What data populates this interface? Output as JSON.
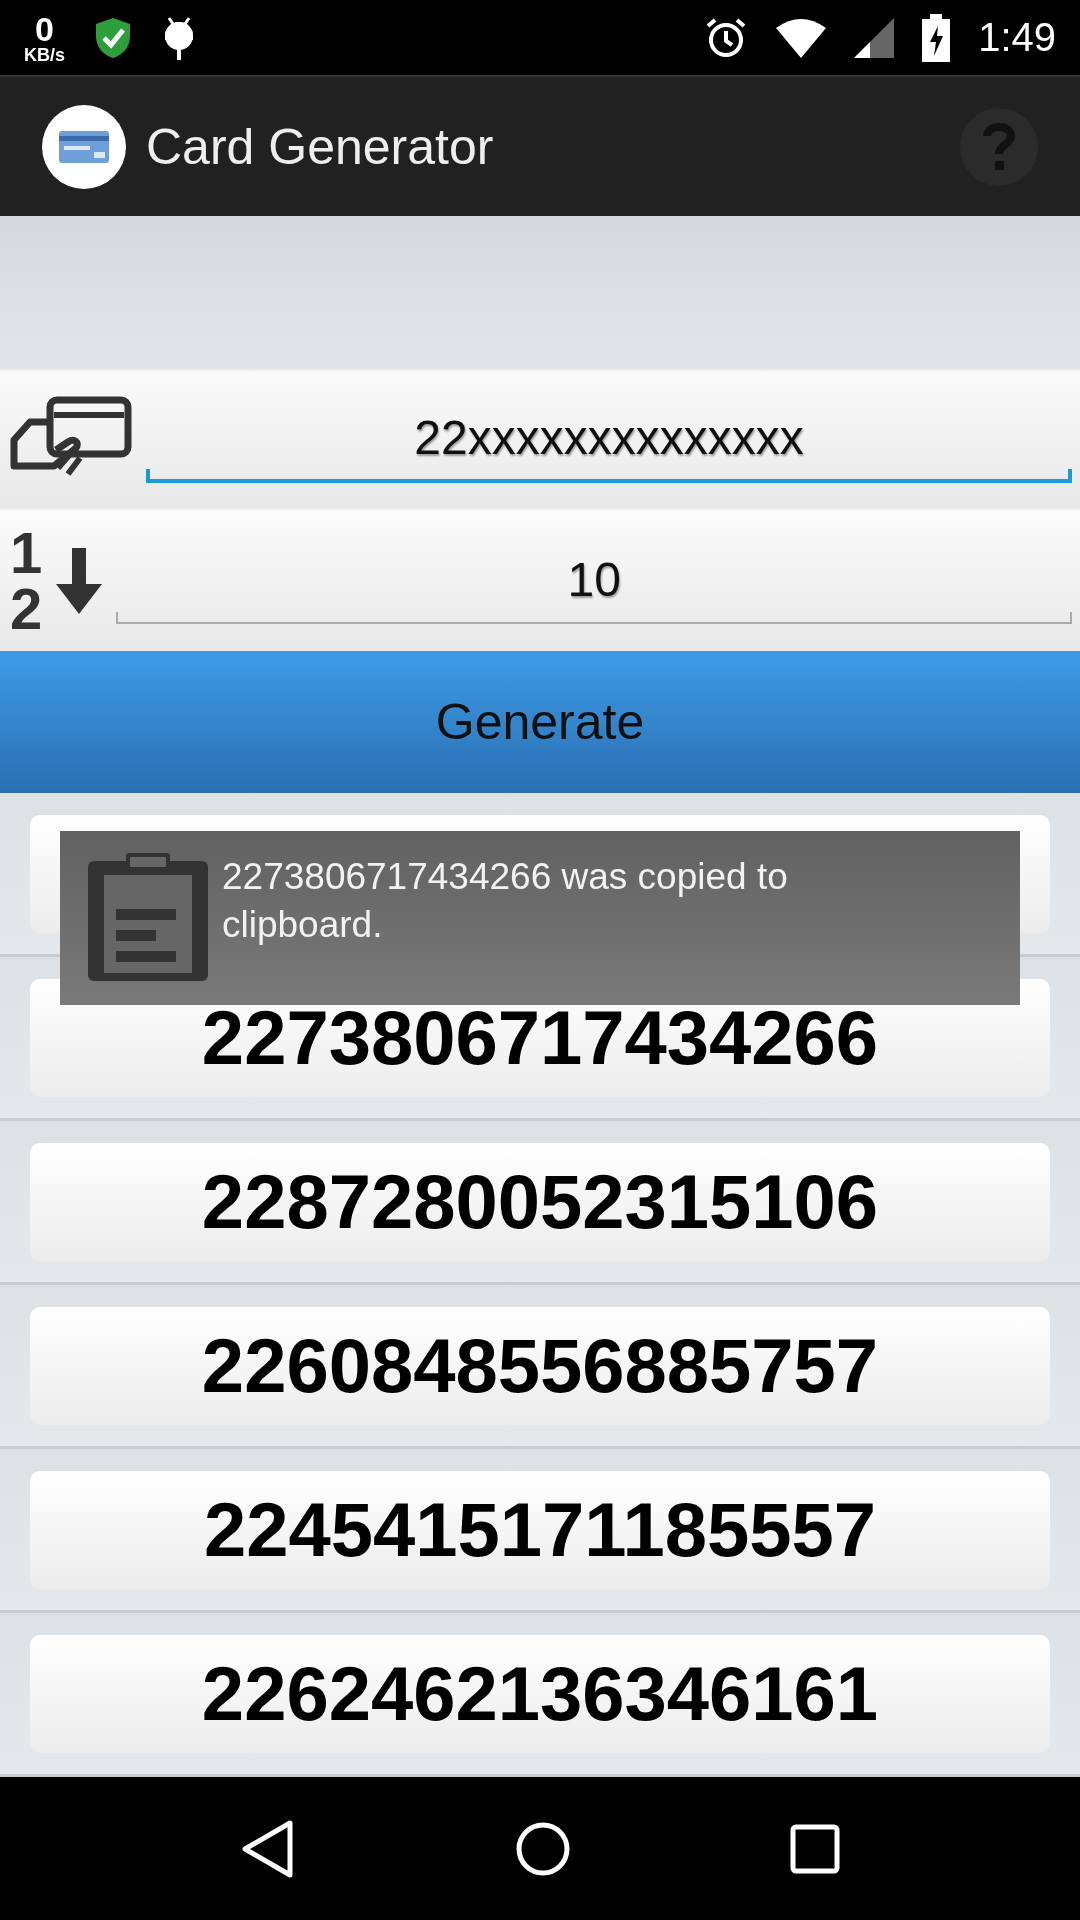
{
  "status_bar": {
    "speed_value": "0",
    "speed_unit": "KB/s",
    "time": "1:49"
  },
  "app_bar": {
    "title": "Card Generator"
  },
  "pattern_field": {
    "value": "22xxxxxxxxxxxxxx",
    "focused": true
  },
  "count_field": {
    "value": "10",
    "focused": false,
    "icon_digits": [
      "1",
      "2"
    ]
  },
  "generate_button": {
    "label": "Generate"
  },
  "results": [
    {
      "number": "2273806717434266"
    },
    {
      "number": "2287280052315106"
    },
    {
      "number": "2260848556885757"
    },
    {
      "number": "2245415171185557"
    },
    {
      "number": "2262462136346161"
    }
  ],
  "toast": {
    "message": "2273806717434266 was copied to clipboard."
  }
}
